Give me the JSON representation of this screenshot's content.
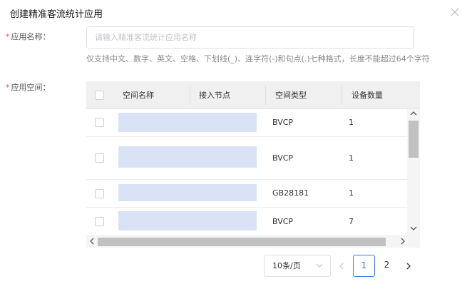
{
  "dialog": {
    "title": "创建精准客流统计应用",
    "close_icon": "close-icon"
  },
  "form": {
    "name": {
      "required_mark": "*",
      "label": "应用名称：",
      "placeholder": "请输入精准客流统计应用名称",
      "value": "",
      "hint": "仅支持中文、数字、英文、空格、下划线(_)、连字符(-)和句点(.)七种格式，长度不能超过64个字符"
    },
    "space": {
      "required_mark": "*",
      "label": "应用空间："
    }
  },
  "table": {
    "columns": [
      "空间名称",
      "接入节点",
      "空间类型",
      "设备数量"
    ],
    "rows": [
      {
        "space_name": "",
        "access_node": "",
        "space_type": "BVCP",
        "device_count": "1"
      },
      {
        "space_name": "",
        "access_node": "",
        "space_type": "BVCP",
        "device_count": "1"
      },
      {
        "space_name": "",
        "access_node": "",
        "space_type": "GB28181",
        "device_count": "1"
      },
      {
        "space_name": "",
        "access_node": "",
        "space_type": "BVCP",
        "device_count": "7"
      }
    ],
    "redaction_color": "#d9e3f5",
    "header_bg": "#f0f0f0"
  },
  "pagination": {
    "page_size": "10条/页",
    "pages": [
      "1",
      "2"
    ],
    "current_page": "1",
    "accent": "#3d7ee0"
  }
}
